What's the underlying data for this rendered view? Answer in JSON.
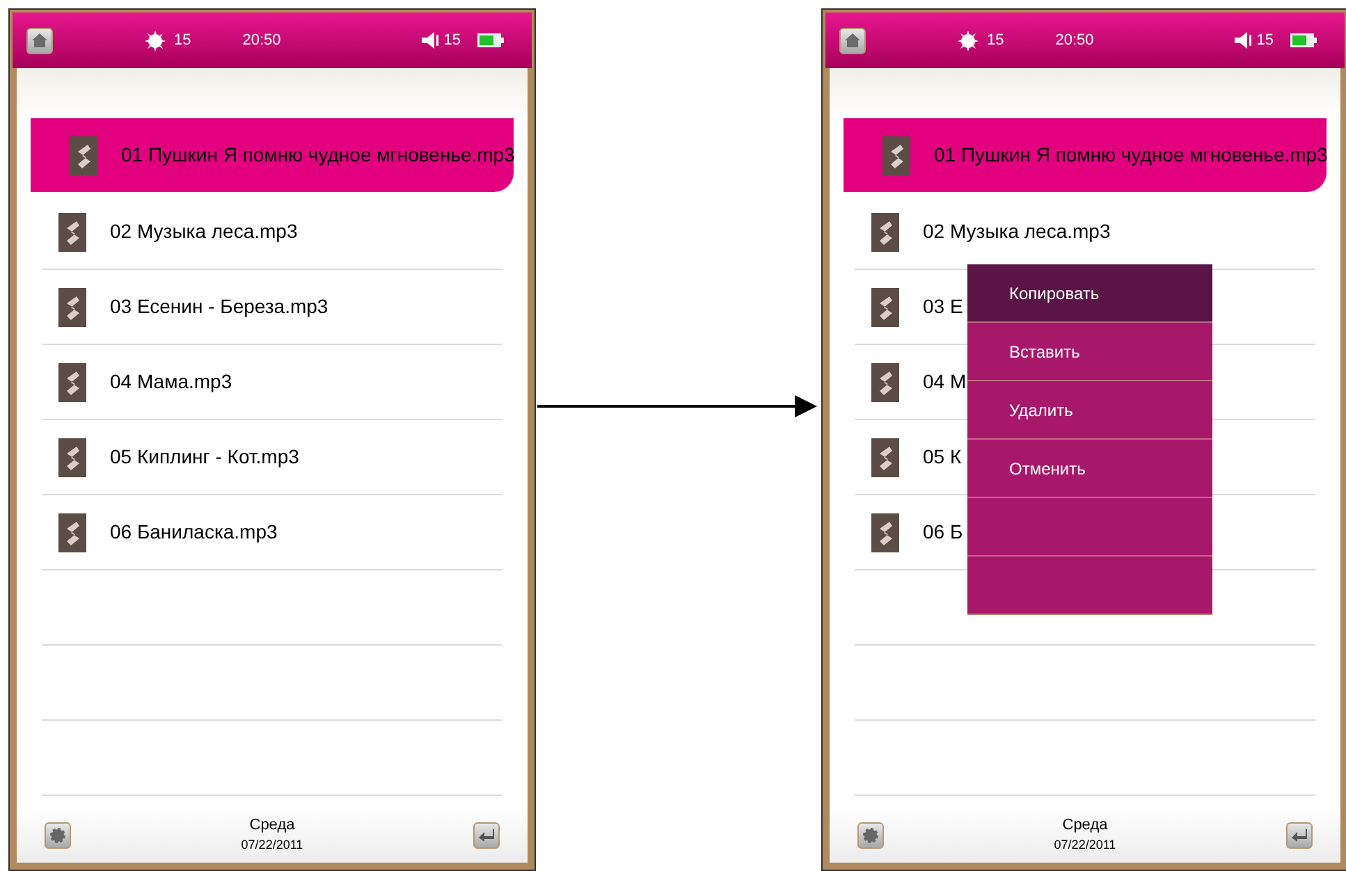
{
  "screens": [
    {
      "status_bar": {
        "brightness": "15",
        "time": "20:50",
        "volume": "15"
      },
      "files": [
        {
          "name": "01 Пушкин  Я помню чудное мгновенье.mp3",
          "selected": true
        },
        {
          "name": "02 Музыка леса.mp3",
          "selected": false
        },
        {
          "name": "03 Есенин - Береза.mp3",
          "selected": false
        },
        {
          "name": "04 Мама.mp3",
          "selected": false
        },
        {
          "name": "05 Киплинг - Кот.mp3",
          "selected": false
        },
        {
          "name": "06 Баниласка.mp3",
          "selected": false
        }
      ],
      "footer": {
        "day": "Среда",
        "date": "07/22/2011"
      }
    },
    {
      "status_bar": {
        "brightness": "15",
        "time": "20:50",
        "volume": "15"
      },
      "files": [
        {
          "name": "01 Пушкин  Я помню чудное мгновенье.mp3",
          "selected": true
        },
        {
          "name": "02 Музыка леса.mp3",
          "selected": false
        },
        {
          "name": "03 Е",
          "selected": false
        },
        {
          "name": "04 М",
          "selected": false
        },
        {
          "name": "05 К",
          "selected": false
        },
        {
          "name": "06 Б",
          "selected": false
        }
      ],
      "context_menu": [
        {
          "label": "Копировать",
          "selected": true
        },
        {
          "label": "Вставить",
          "selected": false
        },
        {
          "label": "Удалить",
          "selected": false
        },
        {
          "label": "Отменить",
          "selected": false
        }
      ],
      "footer": {
        "day": "Среда",
        "date": "07/22/2011"
      }
    }
  ]
}
